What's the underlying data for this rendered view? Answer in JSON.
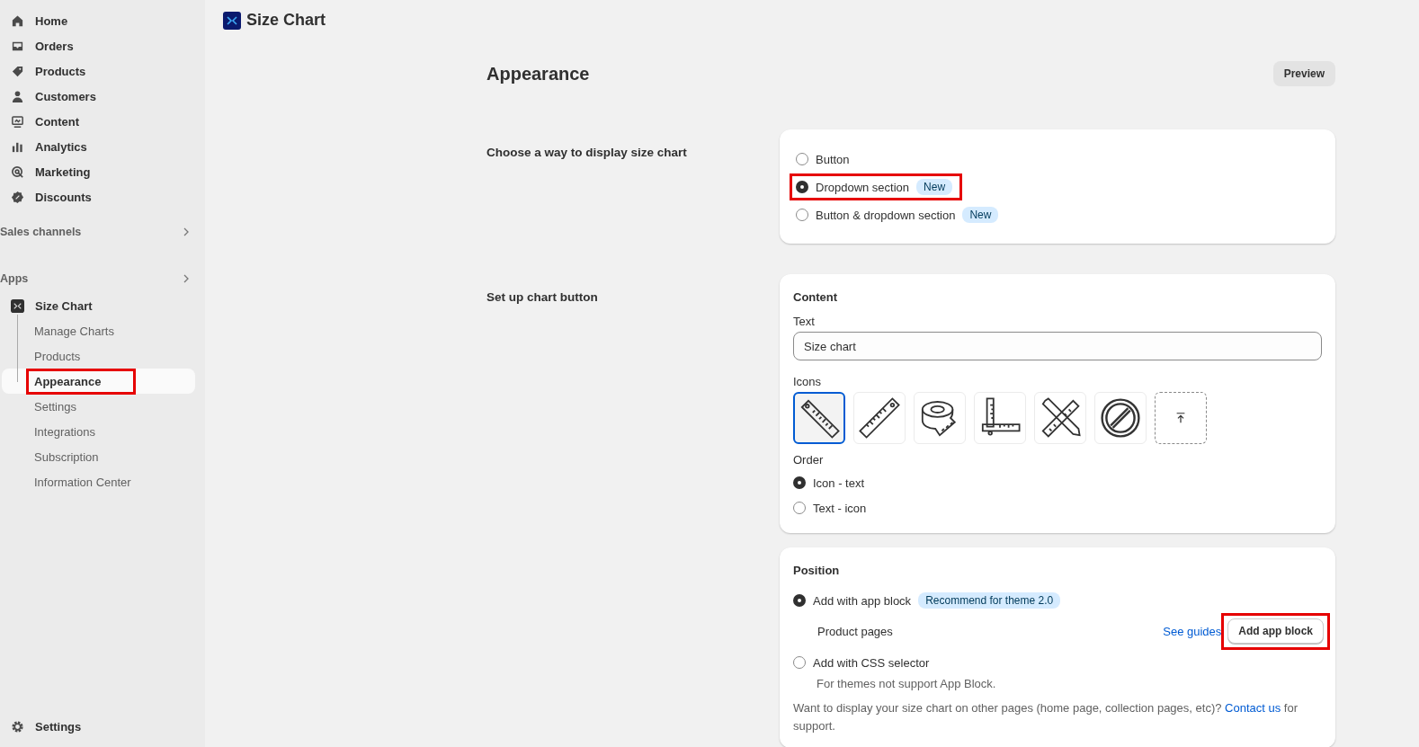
{
  "sidebar": {
    "nav": [
      {
        "label": "Home",
        "kind": "home"
      },
      {
        "label": "Orders",
        "kind": "inbox"
      },
      {
        "label": "Products",
        "kind": "tag"
      },
      {
        "label": "Customers",
        "kind": "person"
      },
      {
        "label": "Content",
        "kind": "monitor"
      },
      {
        "label": "Analytics",
        "kind": "bars"
      },
      {
        "label": "Marketing",
        "kind": "target"
      },
      {
        "label": "Discounts",
        "kind": "badge"
      }
    ],
    "sections": [
      {
        "label": "Sales channels"
      },
      {
        "label": "Apps"
      }
    ],
    "app": {
      "name": "Size Chart",
      "items": [
        {
          "label": "Manage Charts",
          "selected": false,
          "highlighted": false
        },
        {
          "label": "Products",
          "selected": false,
          "highlighted": false
        },
        {
          "label": "Appearance",
          "selected": true,
          "highlighted": true
        },
        {
          "label": "Settings",
          "selected": false,
          "highlighted": false
        },
        {
          "label": "Integrations",
          "selected": false,
          "highlighted": false
        },
        {
          "label": "Subscription",
          "selected": false,
          "highlighted": false
        },
        {
          "label": "Information Center",
          "selected": false,
          "highlighted": false
        }
      ]
    },
    "footer": {
      "label": "Settings"
    }
  },
  "header": {
    "title": "Size Chart"
  },
  "page": {
    "title": "Appearance",
    "preview_button": "Preview"
  },
  "display": {
    "label": "Choose a way to display size chart",
    "options": [
      {
        "label": "Button",
        "selected": false,
        "highlighted": false
      },
      {
        "label": "Dropdown section",
        "badge": "New",
        "selected": true,
        "highlighted": true
      },
      {
        "label": "Button & dropdown section",
        "badge": "New",
        "selected": false,
        "highlighted": false
      }
    ]
  },
  "chart_button": {
    "label": "Set up chart button",
    "content_title": "Content",
    "text_label": "Text",
    "text_value": "Size chart",
    "icons_label": "Icons",
    "icons": [
      {
        "kind": "ruler-diagonal",
        "selected": true
      },
      {
        "kind": "ruler",
        "selected": false
      },
      {
        "kind": "tape",
        "selected": false
      },
      {
        "kind": "square",
        "selected": false
      },
      {
        "kind": "pencil-ruler",
        "selected": false
      },
      {
        "kind": "none",
        "selected": false
      },
      {
        "kind": "upload",
        "selected": false
      }
    ],
    "order_label": "Order",
    "order": [
      {
        "label": "Icon - text",
        "selected": true
      },
      {
        "label": "Text - icon",
        "selected": false
      }
    ]
  },
  "position": {
    "title": "Position",
    "options": [
      {
        "label": "Add with app block",
        "badge": "Recommend for theme 2.0",
        "sub": "Product pages",
        "selected": true
      },
      {
        "label": "Add with CSS selector",
        "sub": "For themes not support App Block.",
        "selected": false
      }
    ],
    "guide_link": "See guides",
    "add_button": {
      "label": "Add app block",
      "highlighted": true
    },
    "note": "Want to display your size chart on other pages (home page, collection pages, etc)?",
    "note_link": "Contact us",
    "note_end": "for support."
  }
}
